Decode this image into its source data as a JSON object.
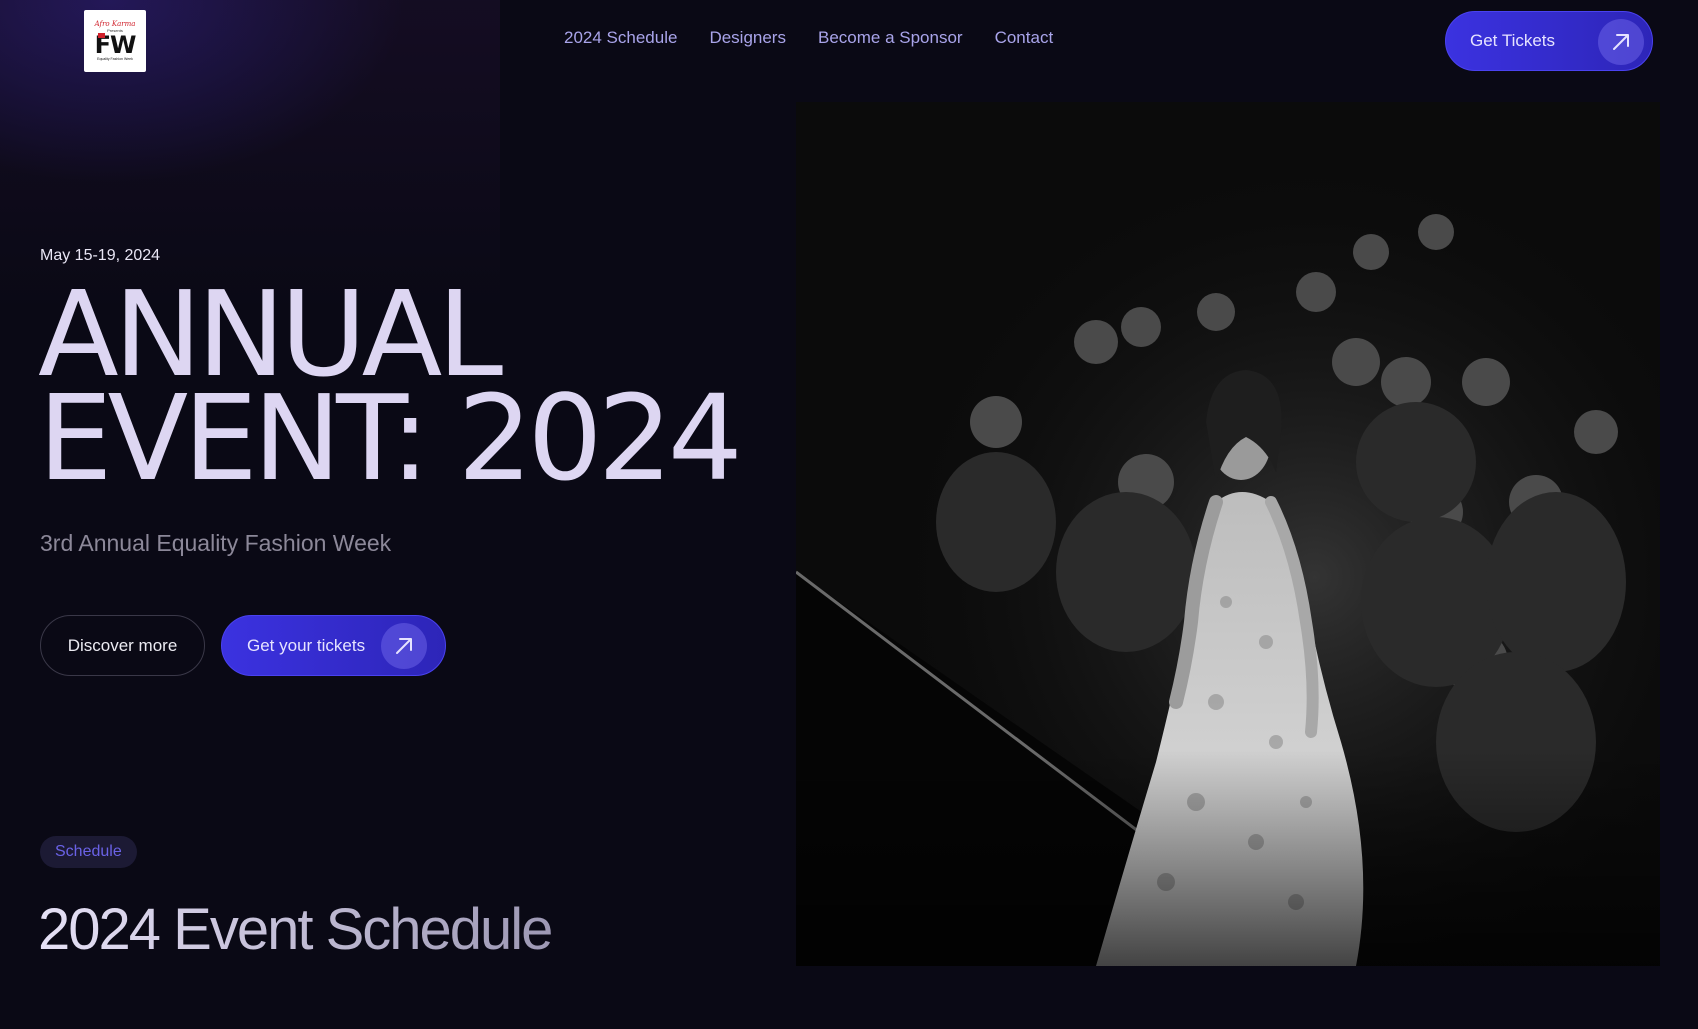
{
  "header": {
    "logo": {
      "scribble": "Afro Karma",
      "tagline": "Presents",
      "letters": "FW",
      "caption": "Equality Fashion Week"
    },
    "nav": [
      {
        "label": "2024 Schedule"
      },
      {
        "label": "Designers"
      },
      {
        "label": "Become a Sponsor"
      },
      {
        "label": "Contact"
      }
    ],
    "cta_label": "Get Tickets"
  },
  "hero": {
    "date": "May 15-19, 2024",
    "headline_line1": "ANNUAL",
    "headline_line2": "EVENT: 2024",
    "subtitle": "3rd Annual Equality Fashion Week",
    "discover_label": "Discover more",
    "tickets_label": "Get your tickets"
  },
  "schedule": {
    "pill": "Schedule",
    "title": "2024 Event Schedule"
  },
  "colors": {
    "background": "#0a0915",
    "accent": "#3b32e0",
    "nav_text": "#a9a4ea",
    "headline": "#ddd6f2"
  },
  "icons": {
    "cta_arrow": "arrow-up-right-icon"
  }
}
